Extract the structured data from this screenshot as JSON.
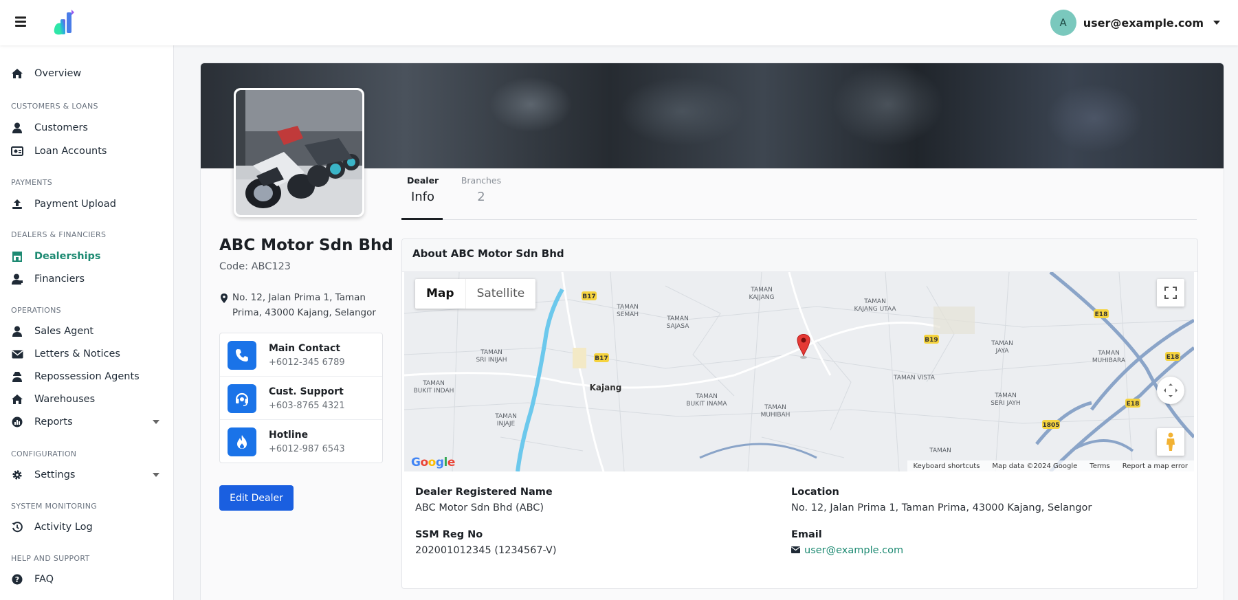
{
  "header": {
    "user_initial": "A",
    "user_email": "user@example.com"
  },
  "sidebar": {
    "overview": "Overview",
    "sections": {
      "customers_loans": "CUSTOMERS & LOANS",
      "payments": "PAYMENTS",
      "dealers_financiers": "DEALERS & FINANCIERS",
      "operations": "OPERATIONS",
      "configuration": "CONFIGURATION",
      "system_monitoring": "SYSTEM MONITORING",
      "help_support": "HELP AND SUPPORT"
    },
    "items": {
      "customers": "Customers",
      "loan_accounts": "Loan Accounts",
      "payment_upload": "Payment Upload",
      "dealerships": "Dealerships",
      "financiers": "Financiers",
      "sales_agent": "Sales Agent",
      "letters_notices": "Letters & Notices",
      "repossession_agents": "Repossession Agents",
      "warehouses": "Warehouses",
      "reports": "Reports",
      "settings": "Settings",
      "activity_log": "Activity Log",
      "faq": "FAQ"
    },
    "active_item": "Dealerships"
  },
  "dealer": {
    "name": "ABC Motor Sdn Bhd",
    "code": "Code: ABC123",
    "address": "No. 12, Jalan Prima 1, Taman Prima, 43000 Kajang, Selangor",
    "contacts": [
      {
        "label": "Main Contact",
        "value": "+6012-345 6789",
        "icon": "phone-icon"
      },
      {
        "label": "Cust. Support",
        "value": "+603-8765 4321",
        "icon": "headset-icon"
      },
      {
        "label": "Hotline",
        "value": "+6012-987 6543",
        "icon": "fire-icon"
      }
    ],
    "edit_button": "Edit Dealer"
  },
  "tabs": [
    {
      "top": "Dealer",
      "bottom": "Info",
      "active": true
    },
    {
      "top": "Branches",
      "bottom": "2",
      "active": false
    }
  ],
  "about": {
    "title": "About ABC Motor Sdn Bhd",
    "fields": {
      "registered_name_label": "Dealer Registered Name",
      "registered_name": "ABC Motor Sdn Bhd (ABC)",
      "ssm_label": "SSM Reg No",
      "ssm": "202001012345 (1234567-V)",
      "location_label": "Location",
      "location": "No. 12, Jalan Prima 1, Taman Prima, 43000 Kajang, Selangor",
      "email_label": "Email",
      "email": "user@example.com"
    }
  },
  "map": {
    "toggle_map": "Map",
    "toggle_satellite": "Satellite",
    "footer": [
      "Keyboard shortcuts",
      "Map data ©2024 Google",
      "Terms",
      "Report a map error"
    ],
    "places": [
      "TAMAN KAJJANG",
      "TAMAN KAJANG UTAA",
      "TAMAN SEMAH",
      "TAMAN SAJASA",
      "TAMAN SRI INIJAH",
      "TAMAN BUKIT INDAH",
      "Kajang",
      "TAMAN BUKIT INAMA",
      "TAMAN MUHIBAH",
      "TAMAN VISTA",
      "TAMAN JAYA",
      "TAMAN MUHIBARA",
      "TAMAN SERI JAYH",
      "TAMAN INJAJE",
      "TAMAN"
    ],
    "road_labels": [
      "B17",
      "B17",
      "B19",
      "E18",
      "E18",
      "E18",
      "1805"
    ]
  }
}
